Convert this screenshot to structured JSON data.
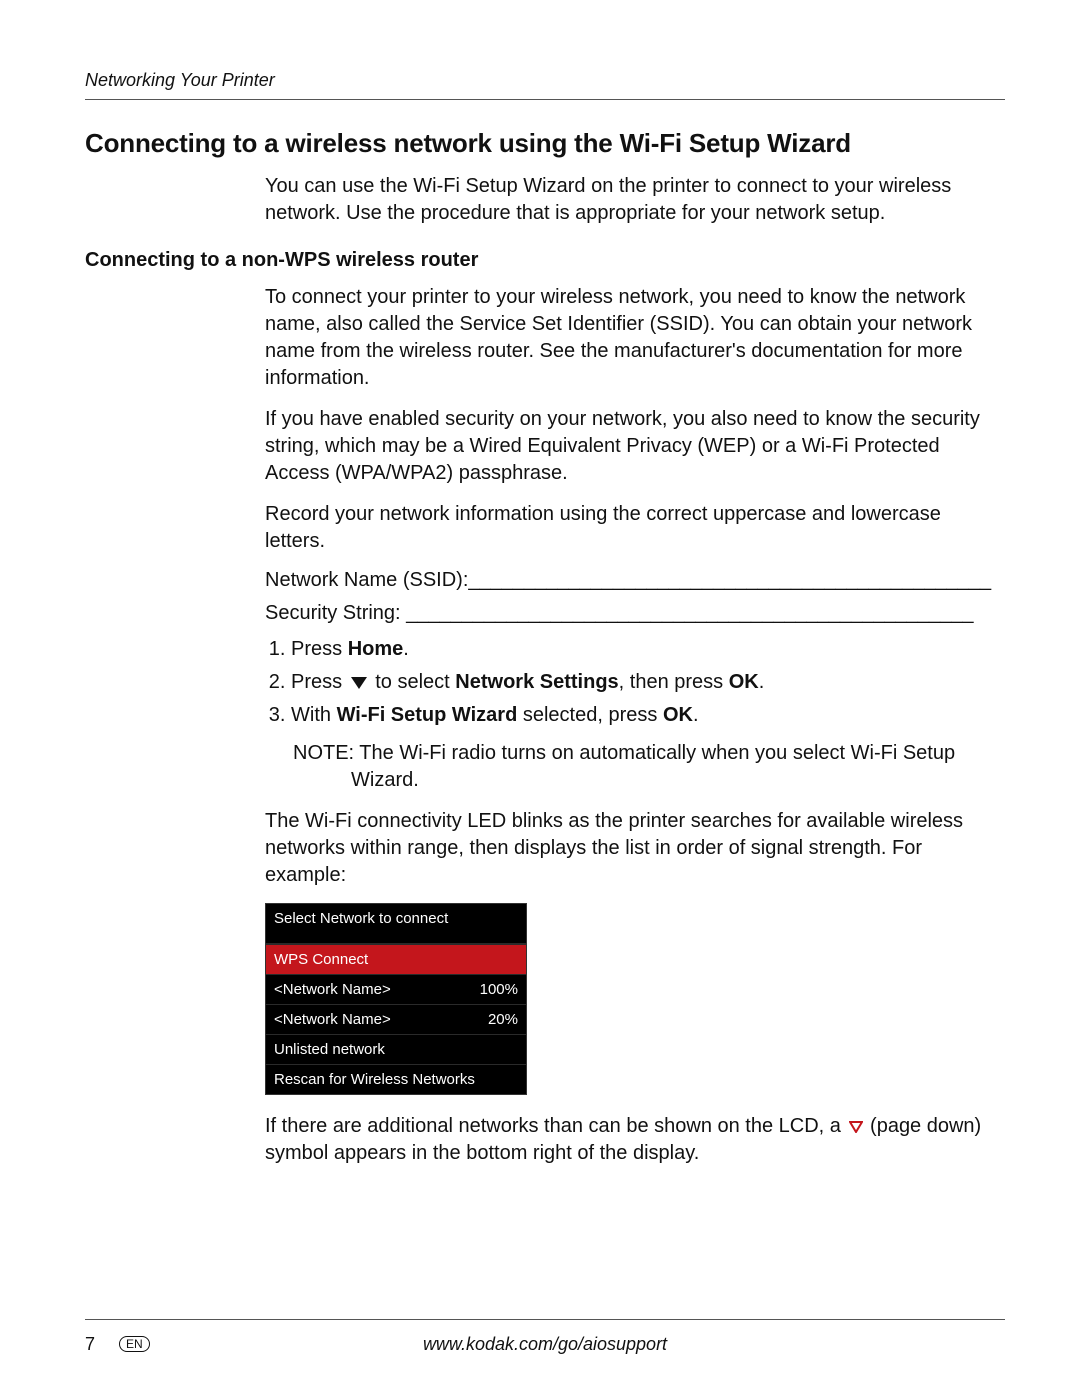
{
  "header": {
    "running_title": "Networking Your Printer"
  },
  "title": "Connecting to a wireless network using the Wi-Fi Setup Wizard",
  "intro": "You can use the Wi-Fi Setup Wizard on the printer to connect to your wireless network. Use the procedure that is appropriate for your network setup.",
  "subheading": "Connecting to a non-WPS wireless router",
  "p1": "To connect your printer to your wireless network, you need to know the network name, also called the Service Set Identifier (SSID). You can obtain your network name from the wireless router. See the manufacturer's documentation for more information.",
  "p2": "If you have enabled security on your network, you also need to know the security string, which may be a Wired Equivalent Privacy (WEP) or a Wi-Fi Protected Access (WPA/WPA2) passphrase.",
  "p3": "Record your network information using the correct uppercase and lowercase letters.",
  "blank_ssid": "Network Name (SSID):_______________________________________________",
  "blank_sec": "Security String: ___________________________________________________",
  "steps": {
    "s1a": "Press ",
    "s1b": "Home",
    "s1c": ".",
    "s2a": "Press ",
    "s2b": " to select ",
    "s2c": "Network Settings",
    "s2d": ", then press ",
    "s2e": "OK",
    "s2f": ".",
    "s3a": "With ",
    "s3b": "Wi-Fi Setup Wizard",
    "s3c": " selected, press ",
    "s3d": "OK",
    "s3e": "."
  },
  "note": "NOTE: The Wi-Fi radio turns on automatically when you select Wi-Fi Setup Wizard.",
  "p_led": "The Wi-Fi connectivity LED blinks as the printer searches for available wireless networks within range, then displays the list in order of signal strength. For example:",
  "lcd": {
    "title": "Select Network to connect",
    "rows": [
      {
        "label": "WPS Connect",
        "value": "",
        "wps": true
      },
      {
        "label": "<Network Name>",
        "value": "100%"
      },
      {
        "label": "<Network Name>",
        "value": "20%"
      },
      {
        "label": "Unlisted network",
        "value": ""
      },
      {
        "label": "Rescan for Wireless Networks",
        "value": ""
      }
    ]
  },
  "p_after_a": "If there are additional networks than can be shown on the LCD, a ",
  "p_after_b": " (page down) symbol appears in the bottom right of the display.",
  "footer": {
    "page": "7",
    "lang": "EN",
    "url": "www.kodak.com/go/aiosupport"
  }
}
